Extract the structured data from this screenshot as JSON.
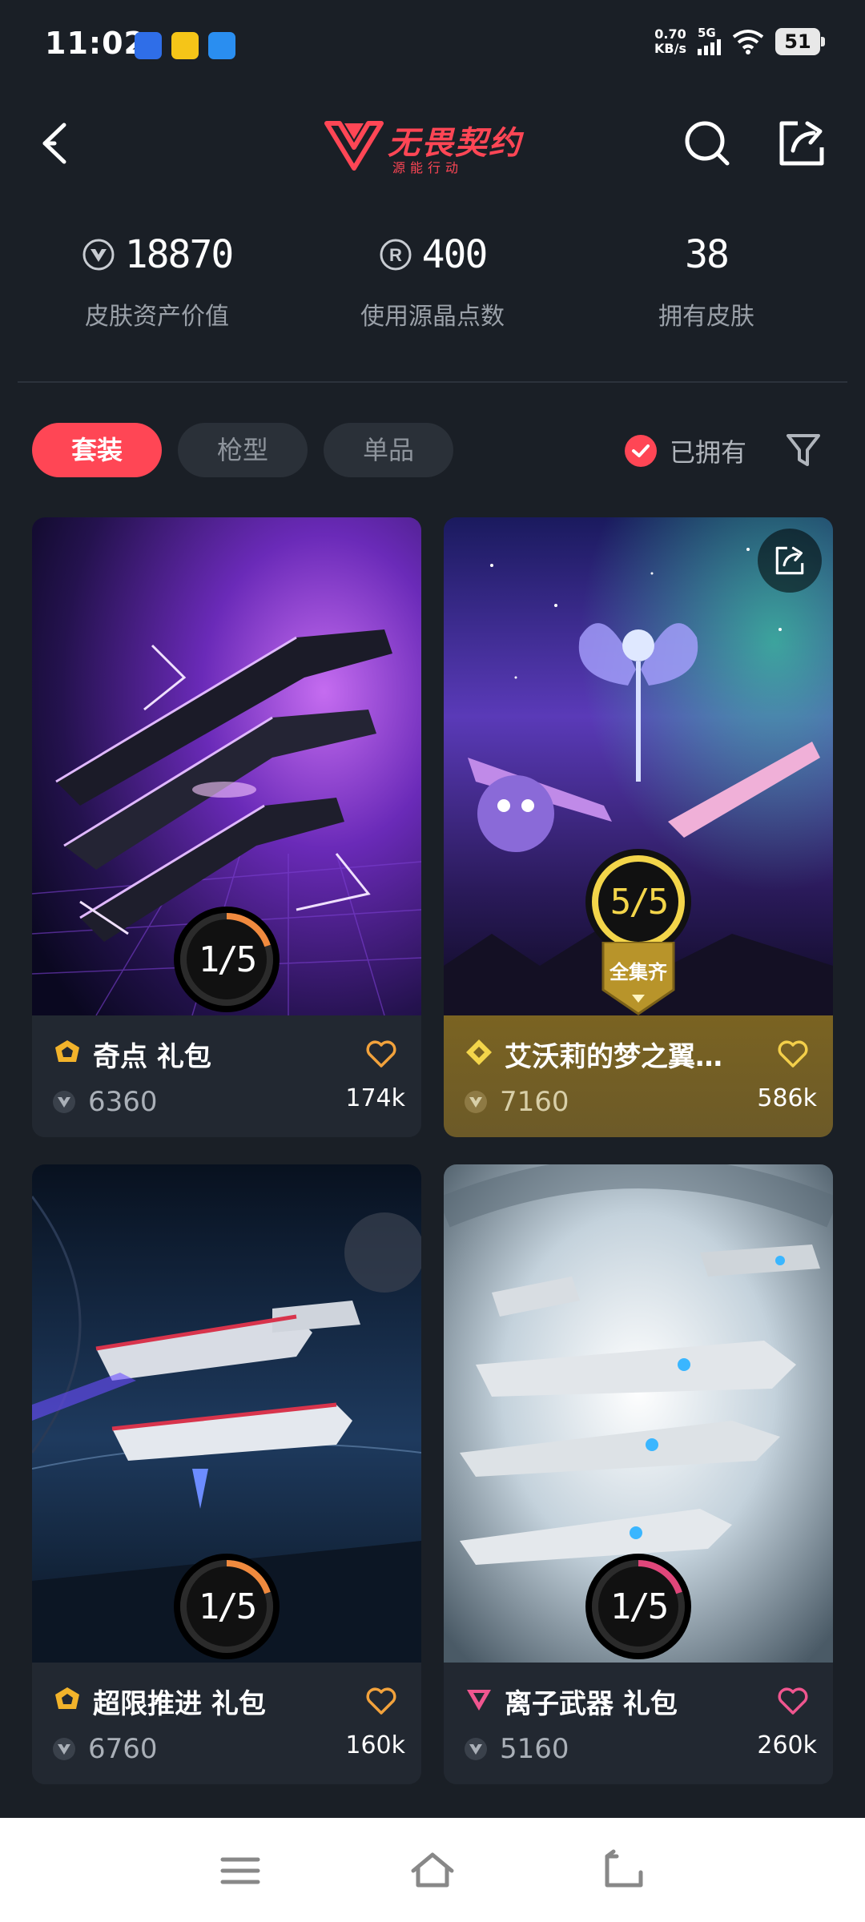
{
  "status_bar": {
    "time": "11:02",
    "net_speed_value": "0.70",
    "net_speed_unit": "KB/s",
    "network": "5G",
    "battery": "51"
  },
  "header": {
    "logo_title": "无畏契约",
    "logo_subtitle": "源能行动"
  },
  "stats": [
    {
      "value": "18870",
      "label": "皮肤资产价值",
      "icon": "vp-coin-icon"
    },
    {
      "value": "400",
      "label": "使用源晶点数",
      "icon": "radianite-icon"
    },
    {
      "value": "38",
      "label": "拥有皮肤"
    }
  ],
  "tabs": [
    {
      "label": "套装",
      "active": true
    },
    {
      "label": "枪型",
      "active": false
    },
    {
      "label": "单品",
      "active": false
    }
  ],
  "owned_filter": {
    "label": "已拥有",
    "checked": true
  },
  "cards": [
    {
      "title": "奇点 礼包",
      "price": "6360",
      "likes": "174k",
      "progress": "1/5",
      "progress_fraction": 0.2,
      "tier_color": "#f2b32b",
      "heart_color": "#f2a23c",
      "theme": "purple"
    },
    {
      "title": "艾沃莉的梦之翼…",
      "price": "7160",
      "likes": "586k",
      "progress": "5/5",
      "progress_fraction": 1.0,
      "complete_label": "全集齐",
      "tier_color": "#f3d54a",
      "heart_color": "#f3cf4a",
      "theme": "galaxy"
    },
    {
      "title": "超限推进 礼包",
      "price": "6760",
      "likes": "160k",
      "progress": "1/5",
      "progress_fraction": 0.2,
      "tier_color": "#f2b32b",
      "heart_color": "#f2a23c",
      "theme": "space"
    },
    {
      "title": "离子武器 礼包",
      "price": "5160",
      "likes": "260k",
      "progress": "1/5",
      "progress_fraction": 0.2,
      "tier_color": "#f0568f",
      "heart_color": "#f0568f",
      "theme": "silver"
    }
  ],
  "colors": {
    "accent": "#ff4655",
    "background": "#1a1f26",
    "gold_footer": "#7a6322"
  }
}
